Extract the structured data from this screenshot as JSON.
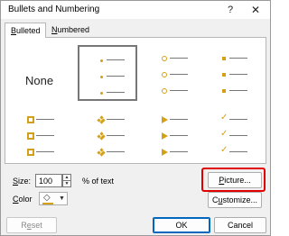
{
  "window": {
    "title": "Bullets and Numbering",
    "help_glyph": "?",
    "close_glyph": "✕"
  },
  "tabs": {
    "bulleted": {
      "prefix": "",
      "accel": "B",
      "rest": "ulleted"
    },
    "numbered": {
      "prefix": "",
      "accel": "N",
      "rest": "umbered"
    }
  },
  "gallery": {
    "none_label": "None",
    "styles_row1": [
      "none",
      "small-dot",
      "hollow-circle",
      "filled-square"
    ],
    "styles_row2": [
      "hollow-square",
      "four-diamond",
      "arrowhead",
      "checkmark"
    ],
    "selected": "small-dot",
    "bullet_color": "#d4a017"
  },
  "size": {
    "label_accel": "S",
    "label_rest": "ize:",
    "value": "100",
    "suffix": "% of text"
  },
  "color": {
    "label_accel": "C",
    "label_rest": "olor"
  },
  "buttons": {
    "picture": {
      "accel": "P",
      "rest": "icture..."
    },
    "customize": {
      "accel": "",
      "pre": "C",
      "mid": "u",
      "rest": "stomize..."
    },
    "reset": {
      "pre": "R",
      "mid": "e",
      "rest": "set"
    },
    "ok": "OK",
    "cancel": "Cancel"
  },
  "annotation": {
    "highlight_color": "#e00000"
  }
}
